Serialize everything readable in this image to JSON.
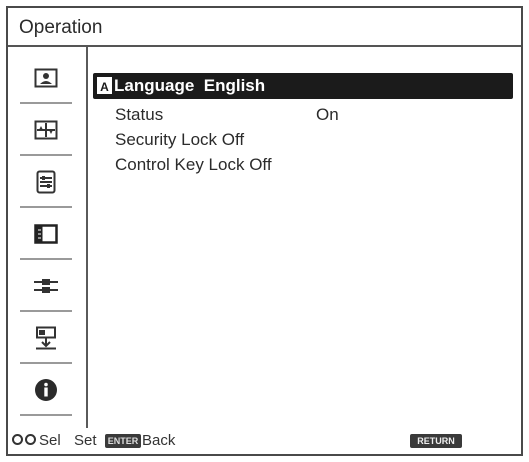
{
  "window": {
    "title": "Operation"
  },
  "sidebar": {
    "items": [
      {
        "icon": "picture-icon"
      },
      {
        "icon": "screen-icon"
      },
      {
        "icon": "setup-icon"
      },
      {
        "icon": "function-icon"
      },
      {
        "icon": "connection-icon"
      },
      {
        "icon": "installation-icon"
      },
      {
        "icon": "information-icon"
      }
    ]
  },
  "menu": {
    "items": [
      {
        "label": "Language",
        "value": "English"
      },
      {
        "label": "Status",
        "value": "On"
      },
      {
        "label": "Security Lock",
        "value": "Off"
      },
      {
        "label": "Control Key Lock",
        "value": "Off"
      }
    ]
  },
  "footer": {
    "sel": "Sel",
    "set": "Set",
    "enter_badge": "ENTER",
    "back": "Back",
    "return_badge": "RETURN"
  },
  "colors": {
    "highlight": "#1b1b1b",
    "border": "#4a4a4a"
  }
}
